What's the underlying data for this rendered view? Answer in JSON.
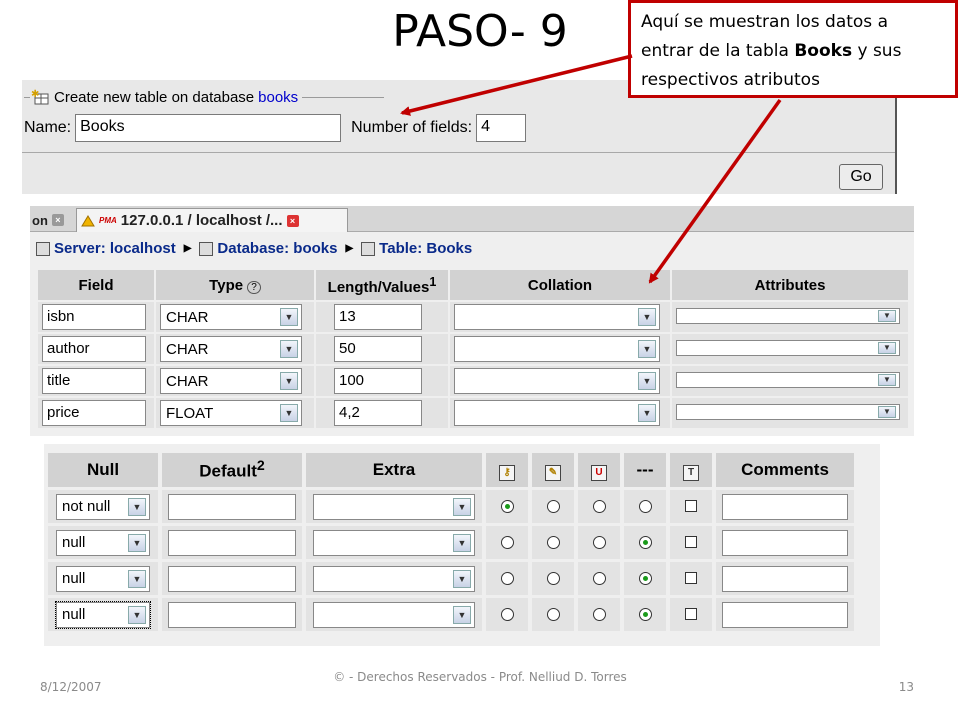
{
  "slide": {
    "title": "PASO- 9",
    "callout": {
      "text_before": "Aquí se muestran los datos a entrar de la tabla ",
      "bold": "Books",
      "text_after": " y sus respectivos atributos"
    },
    "footer": {
      "date": "8/12/2007",
      "copyright": "© - Derechos Reservados  - Prof. Nelliud D. Torres",
      "page": "13"
    },
    "arrow_color": "#c00000"
  },
  "create_table": {
    "legend_text": "Create new table on database",
    "database": "books",
    "name_label": "Name:",
    "name_value": "Books",
    "fields_label": "Number of fields:",
    "fields_value": "4",
    "go_label": "Go"
  },
  "browser": {
    "prev_tab_fragment": "on",
    "tab_badge": "PMA",
    "tab_title": "127.0.0.1 / localhost /...",
    "breadcrumb": {
      "server": "Server: localhost",
      "database": "Database: books",
      "table": "Table: Books"
    }
  },
  "fields_table": {
    "headers": {
      "field": "Field",
      "type": "Type",
      "length": "Length/Values",
      "length_sup": "1",
      "collation": "Collation",
      "attributes": "Attributes"
    },
    "rows": [
      {
        "field": "isbn",
        "type": "CHAR",
        "length": "13"
      },
      {
        "field": "author",
        "type": "CHAR",
        "length": "50"
      },
      {
        "field": "title",
        "type": "CHAR",
        "length": "100"
      },
      {
        "field": "price",
        "type": "FLOAT",
        "length": "4,2"
      }
    ]
  },
  "options_table": {
    "headers": {
      "null": "Null",
      "default": "Default",
      "default_sup": "2",
      "extra": "Extra",
      "none": "---",
      "comments": "Comments"
    },
    "rows": [
      {
        "null": "not null",
        "selected": "primary"
      },
      {
        "null": "null",
        "selected": "none"
      },
      {
        "null": "null",
        "selected": "none"
      },
      {
        "null": "null",
        "selected": "none"
      }
    ]
  }
}
